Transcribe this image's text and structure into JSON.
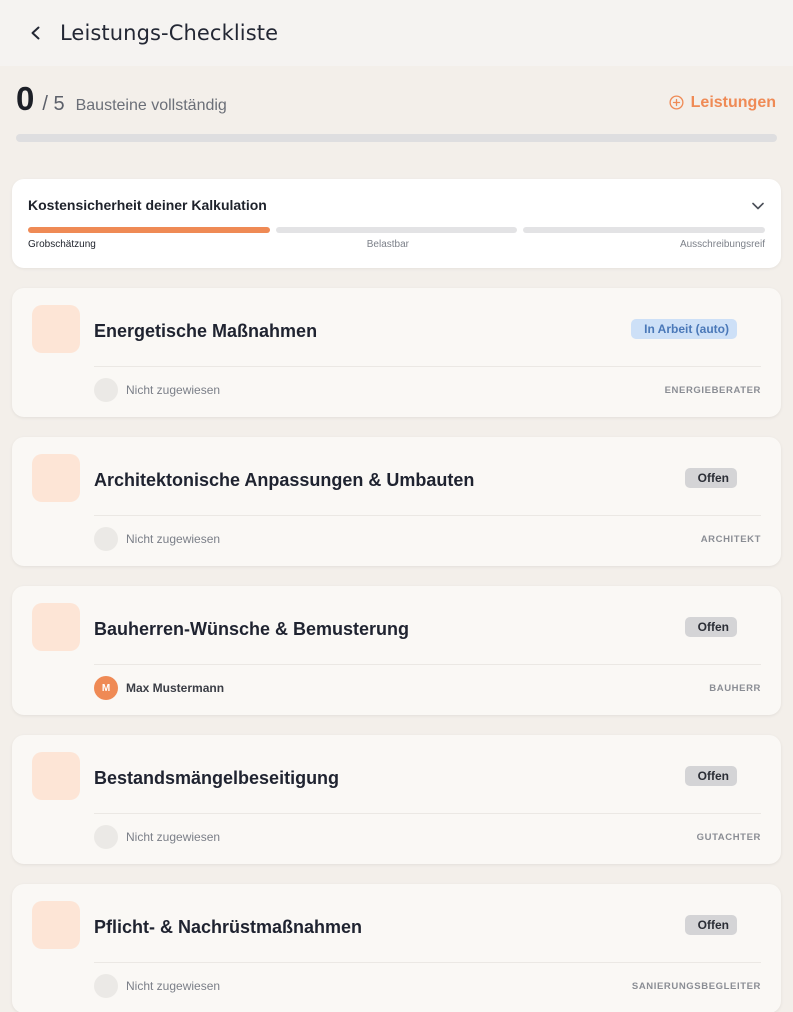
{
  "header": {
    "title": "Leistungs-Checkliste",
    "back_icon": "chevron-left-icon"
  },
  "progress": {
    "done": "0",
    "total": "/ 5",
    "label": "Bausteine vollständig",
    "fraction": 0,
    "add_button_label": "Leistungen",
    "add_button_icon": "plus-circle-icon"
  },
  "cost_certainty": {
    "title": "Kostensicherheit deiner Kalkulation",
    "levels": [
      "Grobschätzung",
      "Belastbar",
      "Ausschreibungsreif"
    ],
    "active_level": 0
  },
  "tasks": [
    {
      "title": "Energetische Maßnahmen",
      "icon": "leaf-icon",
      "status": "In Arbeit (auto)",
      "status_type": "progress",
      "assignee": "Nicht zugewiesen",
      "assignee_initial": "",
      "role": "ENERGIEBERATER"
    },
    {
      "title": "Architektonische Anpassungen & Umbauten",
      "icon": "hammer-icon",
      "status": "Offen",
      "status_type": "offen",
      "assignee": "Nicht zugewiesen",
      "assignee_initial": "",
      "role": "ARCHITEKT"
    },
    {
      "title": "Bauherren-Wünsche & Bemusterung",
      "icon": "palette-icon",
      "status": "Offen",
      "status_type": "offen",
      "assignee": "Max Mustermann",
      "assignee_initial": "M",
      "role": "BAUHERR"
    },
    {
      "title": "Bestandsmängelbeseitigung",
      "icon": "warning-icon",
      "status": "Offen",
      "status_type": "offen",
      "assignee": "Nicht zugewiesen",
      "assignee_initial": "",
      "role": "GUTACHTER"
    },
    {
      "title": "Pflicht- & Nachrüstmaßnahmen",
      "icon": "shield-check-icon",
      "status": "Offen",
      "status_type": "offen",
      "assignee": "Nicht zugewiesen",
      "assignee_initial": "",
      "role": "SANIERUNGSBEGLEITER"
    }
  ],
  "colors": {
    "accent": "#ef8a55",
    "progress_badge": "#cde0f7",
    "offen_badge": "#d4d4d6"
  }
}
